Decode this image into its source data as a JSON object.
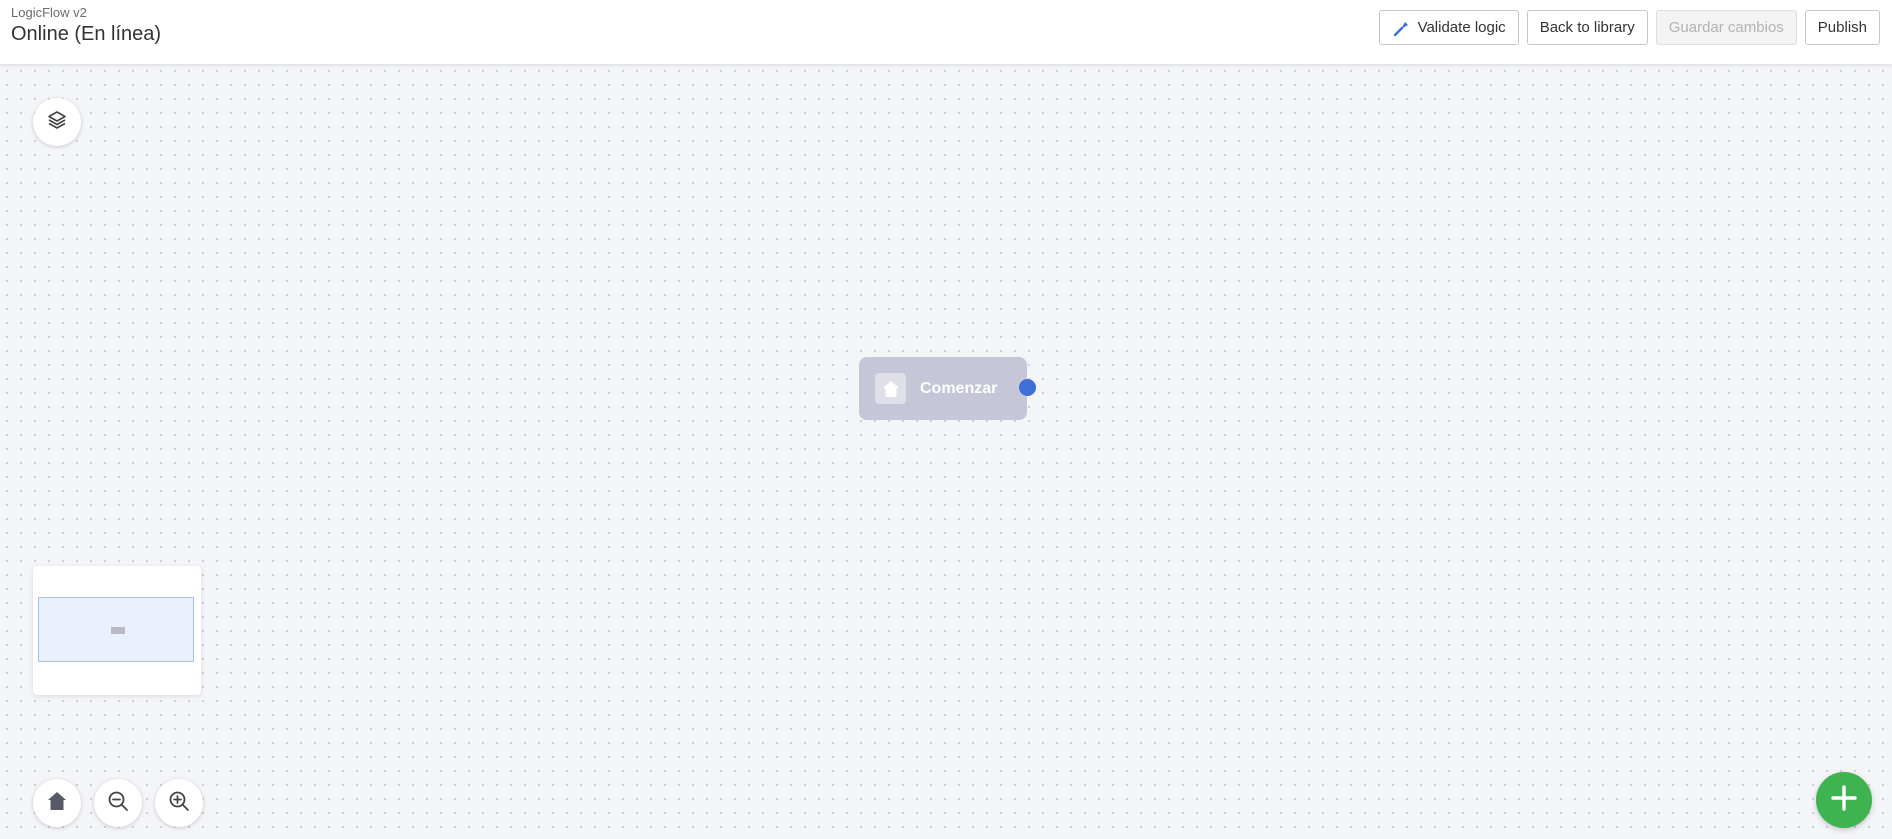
{
  "header": {
    "app_name": "LogicFlow v2",
    "flow_title": "Online (En línea)"
  },
  "toolbar": {
    "validate_label": "Validate logic",
    "back_label": "Back to library",
    "save_label": "Guardar cambios",
    "publish_label": "Publish",
    "validate_icon": "wand-icon"
  },
  "canvas": {
    "layers_icon": "layers-icon",
    "start_node": {
      "label": "Comenzar",
      "icon": "home-icon",
      "port_color": "#3f6fd6"
    }
  },
  "controls": {
    "fit_icon": "home-icon",
    "zoom_out_icon": "zoom-out-icon",
    "zoom_in_icon": "zoom-in-icon",
    "add_icon": "plus-icon"
  },
  "colors": {
    "accent_blue": "#3f6fd6",
    "fab_green": "#3fb34f",
    "node_bg": "#c5c6d7"
  }
}
